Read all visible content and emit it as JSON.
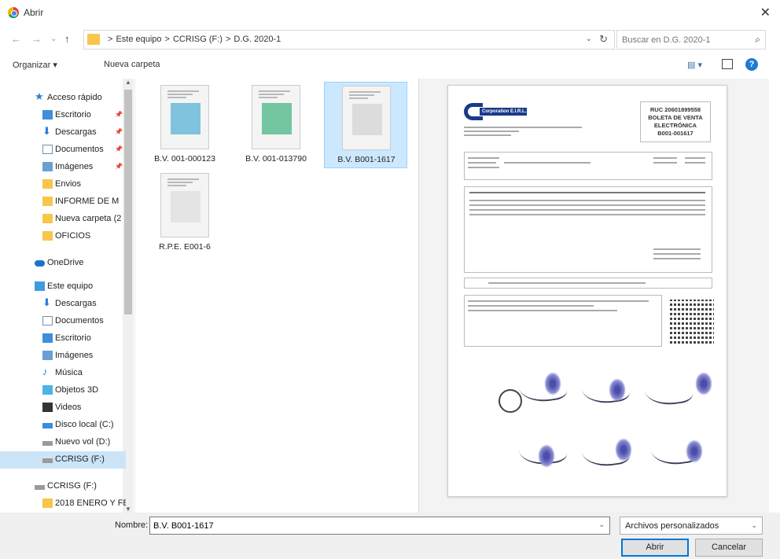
{
  "window": {
    "title": "Abrir",
    "close_glyph": "✕"
  },
  "addressbar": {
    "back": "←",
    "forward": "→",
    "recent": "⌄",
    "up": "↑",
    "path": [
      "Este equipo",
      "CCRISG (F:)",
      "D.G. 2020-1"
    ],
    "separator": ">",
    "refresh": "↻",
    "search_placeholder": "Buscar en D.G. 2020-1"
  },
  "toolbar": {
    "organize": "Organizar ▾",
    "new_folder": "Nueva carpeta",
    "view": "▤ ▾",
    "help": "?"
  },
  "navpane": {
    "items": [
      {
        "label": "Acceso rápido",
        "icon": "star-icon",
        "indent": 0,
        "pinned": false
      },
      {
        "label": "Escritorio",
        "icon": "desktop-icon",
        "indent": 1,
        "pinned": true
      },
      {
        "label": "Descargas",
        "icon": "download-icon",
        "indent": 1,
        "pinned": true
      },
      {
        "label": "Documentos",
        "icon": "document-icon",
        "indent": 1,
        "pinned": true
      },
      {
        "label": "Imágenes",
        "icon": "pictures-icon",
        "indent": 1,
        "pinned": true
      },
      {
        "label": "Envios",
        "icon": "folder-icon",
        "indent": 1,
        "pinned": false
      },
      {
        "label": "INFORME DE M",
        "icon": "folder-icon",
        "indent": 1,
        "pinned": false
      },
      {
        "label": "Nueva carpeta (2",
        "icon": "folder-icon",
        "indent": 1,
        "pinned": false
      },
      {
        "label": "OFICIOS",
        "icon": "folder-icon",
        "indent": 1,
        "pinned": false
      },
      {
        "label": "OneDrive",
        "icon": "onedrive-icon",
        "indent": 0,
        "pinned": false
      },
      {
        "label": "Este equipo",
        "icon": "computer-icon",
        "indent": 0,
        "pinned": false
      },
      {
        "label": "Descargas",
        "icon": "download-icon",
        "indent": 1,
        "pinned": false
      },
      {
        "label": "Documentos",
        "icon": "document-icon",
        "indent": 1,
        "pinned": false
      },
      {
        "label": "Escritorio",
        "icon": "desktop-icon",
        "indent": 1,
        "pinned": false
      },
      {
        "label": "Imágenes",
        "icon": "pictures-icon",
        "indent": 1,
        "pinned": false
      },
      {
        "label": "Música",
        "icon": "music-icon",
        "indent": 1,
        "pinned": false
      },
      {
        "label": "Objetos 3D",
        "icon": "objects-3d-icon",
        "indent": 1,
        "pinned": false
      },
      {
        "label": "Videos",
        "icon": "video-icon",
        "indent": 1,
        "pinned": false
      },
      {
        "label": "Disco local (C:)",
        "icon": "local-disk-icon",
        "indent": 1,
        "pinned": false
      },
      {
        "label": "Nuevo vol (D:)",
        "icon": "drive-icon",
        "indent": 1,
        "pinned": false
      },
      {
        "label": "CCRISG (F:)",
        "icon": "drive-icon",
        "indent": 1,
        "pinned": false,
        "selected": true
      },
      {
        "label": "CCRISG (F:)",
        "icon": "drive-icon",
        "indent": 0,
        "pinned": false
      },
      {
        "label": "2018 ENERO Y FE",
        "icon": "folder-icon",
        "indent": 1,
        "pinned": false
      }
    ]
  },
  "files": [
    {
      "name": "B.V. 001-000123",
      "thumb_color": "#7fc3df",
      "selected": false
    },
    {
      "name": "B.V. 001-013790",
      "thumb_color": "#74c6a0",
      "selected": false
    },
    {
      "name": "B.V. B001-1617",
      "thumb_color": "#dcdcdc",
      "selected": true
    },
    {
      "name": "R.P.E. E001-6",
      "thumb_color": "#e4e4e4",
      "selected": false
    }
  ],
  "preview": {
    "brand": "Corporation E.I.R.L.",
    "ruc": "RUC 20601899558",
    "doc_type_1": "BOLETA DE VENTA",
    "doc_type_2": "ELECTRÓNICA",
    "doc_number": "B001-001617"
  },
  "footer": {
    "name_label": "Nombre:",
    "name_value": "B.V. B001-1617",
    "filter_value": "Archivos personalizados",
    "open_label": "Abrir",
    "cancel_label": "Cancelar"
  }
}
